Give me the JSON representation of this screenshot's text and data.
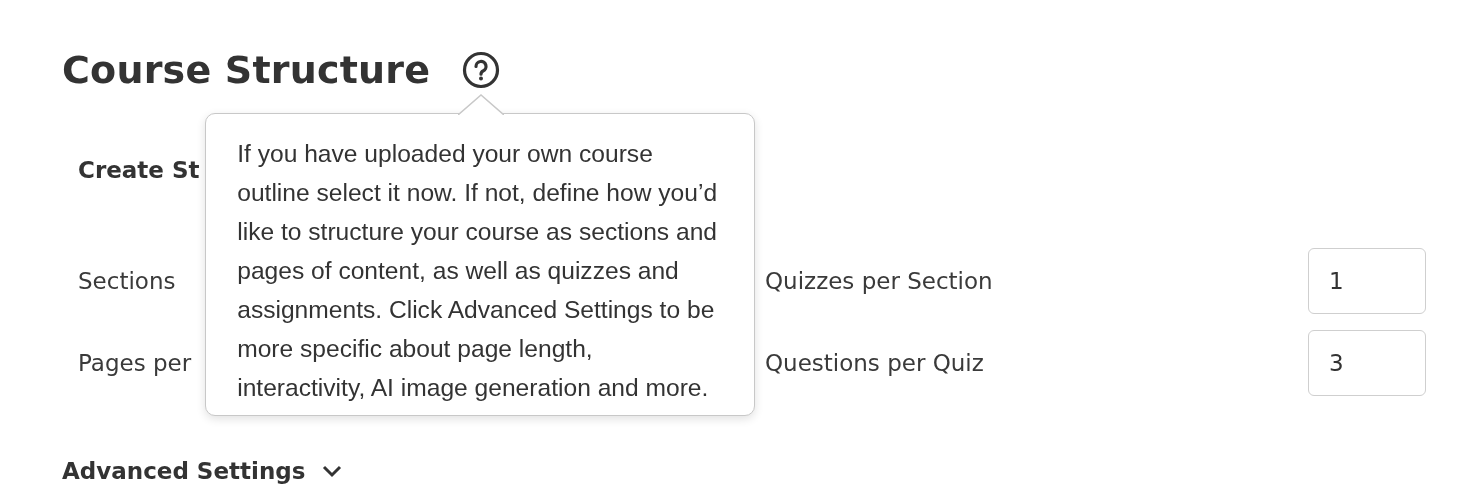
{
  "title": "Course Structure",
  "help_popover": {
    "text": "If you have uploaded your own course outline select it now. If not, define how you’d like to structure your course as sections and pages of content, as well as quizzes and assignments. Click Advanced Settings to be more specific about page length, interactivity, AI image generation and more."
  },
  "form": {
    "heading": "Create St",
    "rows": [
      {
        "left_label": "Sections",
        "right_label": "Quizzes per Section",
        "right_value": "1"
      },
      {
        "left_label": "Pages per",
        "right_label": "Questions per Quiz",
        "right_value": "3"
      }
    ]
  },
  "advanced_settings": {
    "label": "Advanced Settings"
  }
}
